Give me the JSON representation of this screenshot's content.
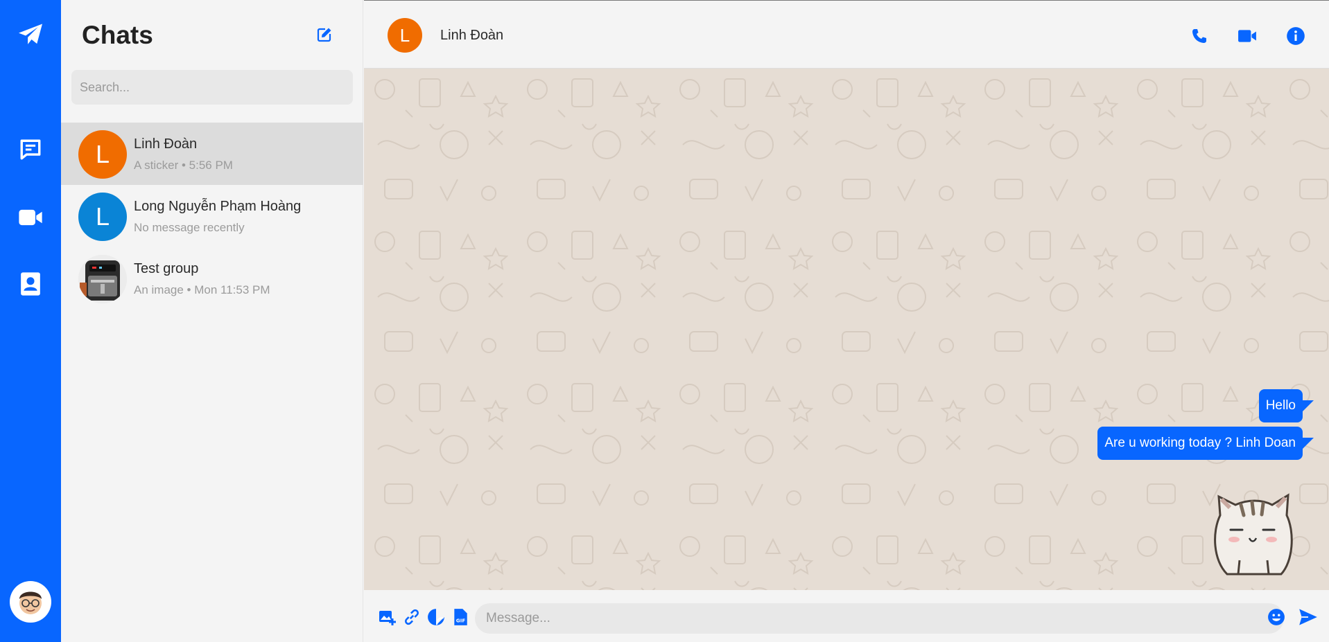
{
  "colors": {
    "accent": "#0866ff",
    "avatar_orange": "#f06c00",
    "avatar_blue": "#0a84d6",
    "chat_bg": "#e6ddd4"
  },
  "nav": {
    "icons": [
      "paper-plane-icon",
      "chat-icon",
      "video-icon",
      "contacts-icon"
    ],
    "profile": "user-avatar"
  },
  "sidebar": {
    "title": "Chats",
    "search_placeholder": "Search..."
  },
  "conversations": [
    {
      "name": "Linh Đoàn",
      "preview": "A sticker • 5:56 PM",
      "initial": "L",
      "color": "#f06c00",
      "active": true
    },
    {
      "name": "Long Nguyễn Phạm Hoàng",
      "preview": "No message recently",
      "initial": "L",
      "color": "#0a84d6",
      "active": false
    },
    {
      "name": "Test group",
      "preview": "An image • Mon 11:53 PM",
      "initial": "",
      "color": "",
      "active": false
    }
  ],
  "header": {
    "initial": "L",
    "name": "Linh Đoàn"
  },
  "messages": [
    {
      "text": "Hello",
      "type": "text",
      "outgoing": true
    },
    {
      "text": "Are u working today ? Linh Doan",
      "type": "text",
      "outgoing": true
    },
    {
      "type": "sticker",
      "outgoing": true
    }
  ],
  "composer": {
    "placeholder": "Message...",
    "tools": [
      "add-image-icon",
      "link-icon",
      "sticker-icon",
      "gif-icon"
    ]
  }
}
